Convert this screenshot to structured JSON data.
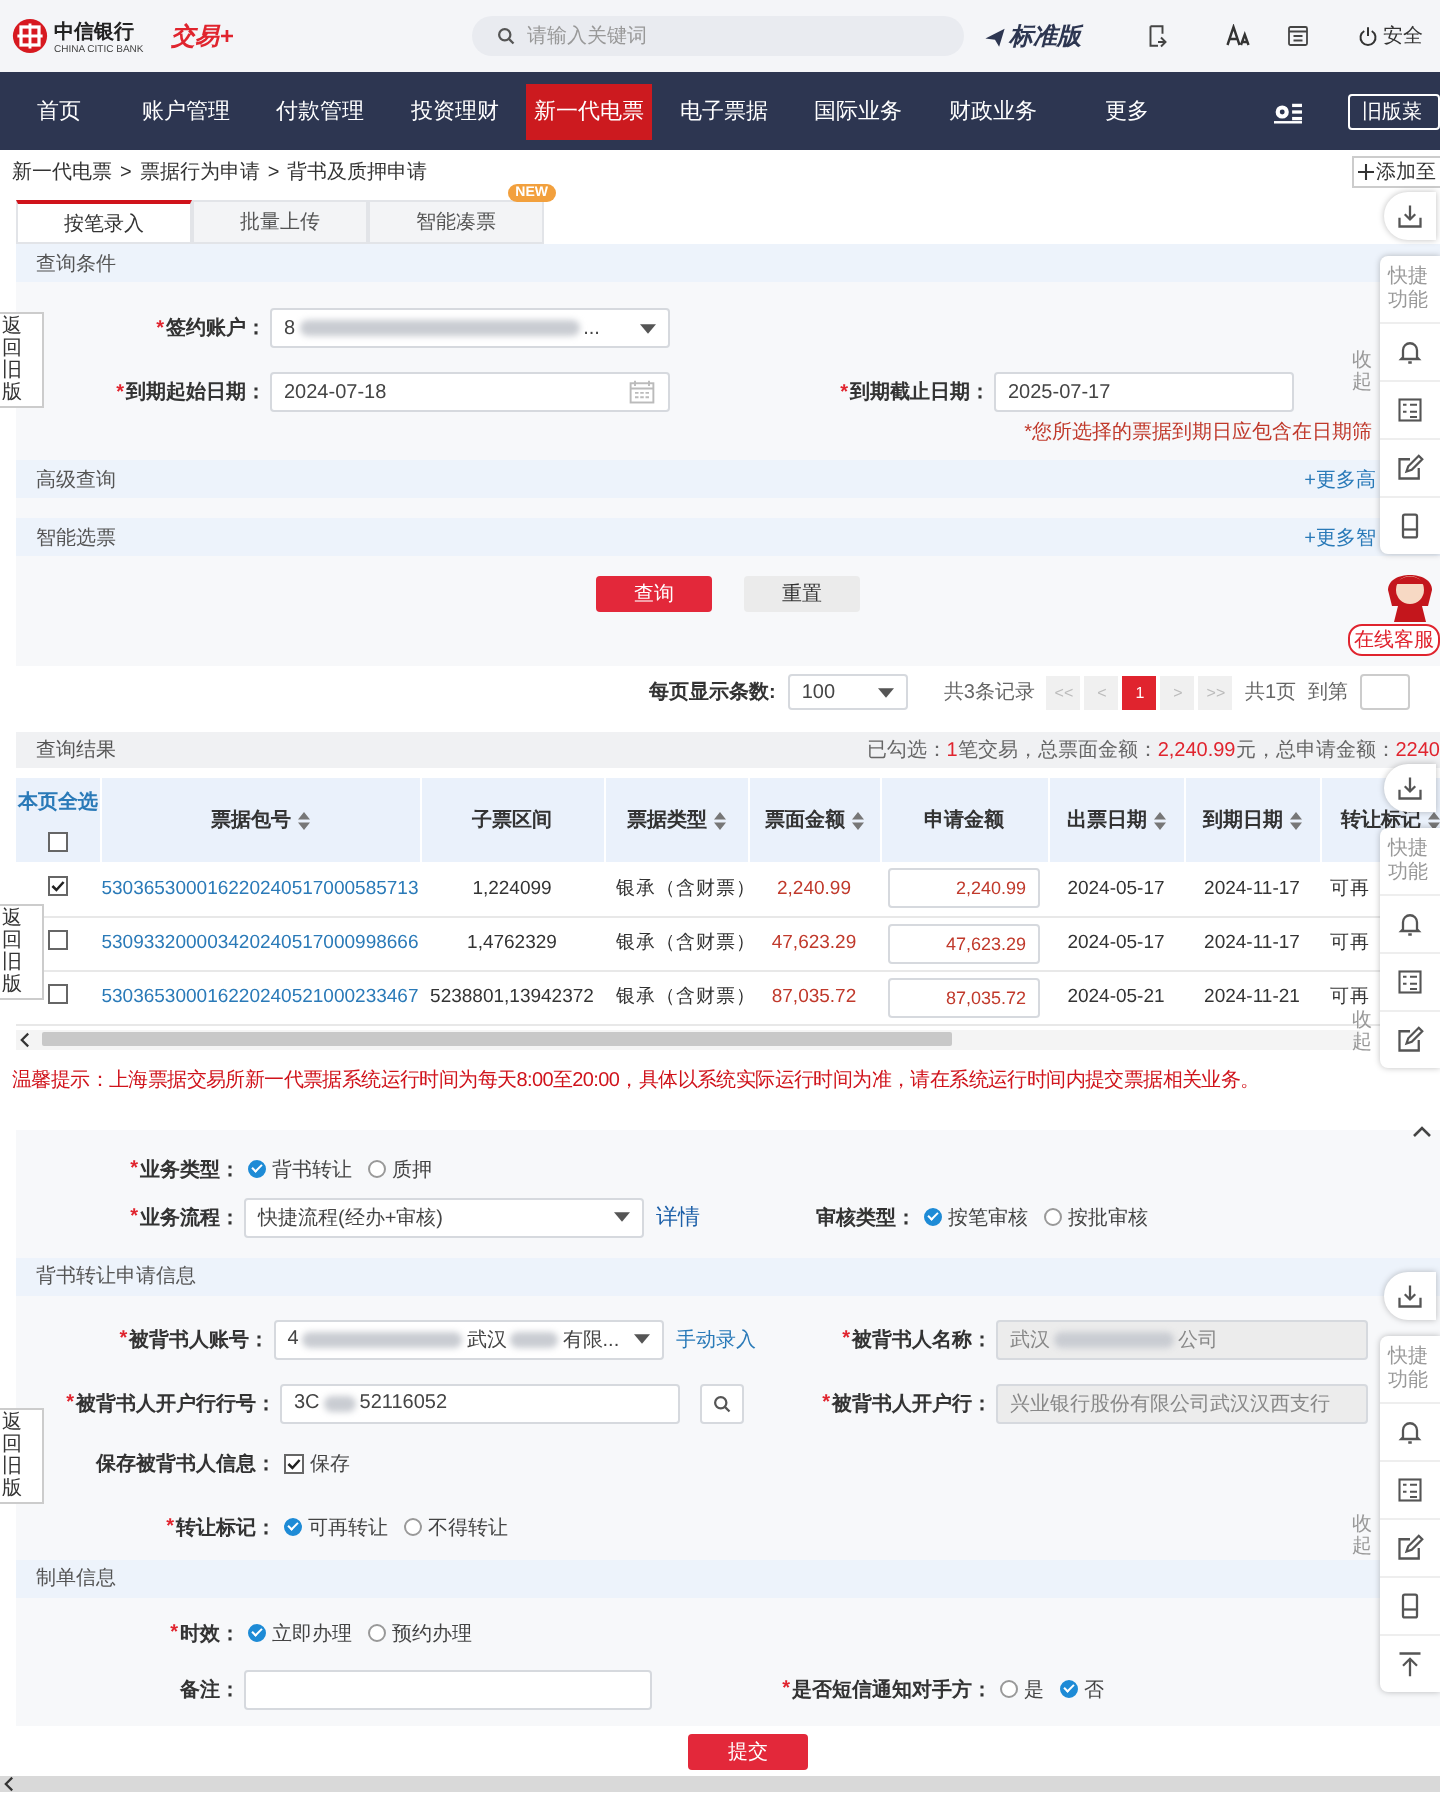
{
  "header": {
    "bank_name": "中信银行",
    "bank_name_en": "CHINA CITIC BANK",
    "app_logo": "交易+",
    "search": {
      "placeholder": "请输入关键词"
    },
    "edition": "标准版",
    "security": "安全"
  },
  "nav": {
    "items": [
      {
        "label": "首页",
        "selected": false
      },
      {
        "label": "账户管理",
        "selected": false
      },
      {
        "label": "付款管理",
        "selected": false
      },
      {
        "label": "投资理财",
        "selected": false
      },
      {
        "label": "新一代电票",
        "selected": true
      },
      {
        "label": "电子票据",
        "selected": false
      },
      {
        "label": "国际业务",
        "selected": false
      },
      {
        "label": "财政业务",
        "selected": false
      },
      {
        "label": "更多",
        "selected": false
      }
    ],
    "old_menu": "旧版菜"
  },
  "breadcrumb": {
    "items": [
      "新一代电票",
      "票据行为申请",
      "背书及质押申请"
    ],
    "separator": ">",
    "add": "添加至"
  },
  "tabs": [
    {
      "label": "按笔录入",
      "selected": true
    },
    {
      "label": "批量上传",
      "selected": false
    },
    {
      "label": "智能凑票",
      "selected": false,
      "badge": "NEW"
    }
  ],
  "query": {
    "title": "查询条件",
    "account": {
      "mark": "*",
      "label": "签约账户：",
      "value": "8",
      "value_end": "..."
    },
    "start_date": {
      "mark": "*",
      "label": "到期起始日期：",
      "value": "2024-07-18"
    },
    "end_date": {
      "mark": "*",
      "label": "到期截止日期：",
      "value": "2025-07-17"
    },
    "note": "*您所选择的票据到期日应包含在日期筛",
    "bars": [
      {
        "title": "高级查询",
        "link": "+更多高"
      },
      {
        "title": "智能选票",
        "link": "+更多智"
      }
    ],
    "buttons": [
      {
        "label": "查询",
        "kind": "primary"
      },
      {
        "label": "重置",
        "kind": "secondary"
      }
    ]
  },
  "pager": {
    "size_label": "每页显示条数:",
    "size": "100",
    "total": "共3条记录",
    "pages": [
      {
        "label": "<<",
        "selected": false
      },
      {
        "label": "<",
        "selected": false
      },
      {
        "label": "1",
        "selected": true
      },
      {
        "label": ">",
        "selected": false
      },
      {
        "label": ">>",
        "selected": false
      }
    ],
    "page_count": "共1页",
    "goto_label": "到第"
  },
  "results": {
    "title": "查询结果",
    "summary": [
      {
        "text": "已勾选：",
        "kind": "label"
      },
      {
        "text": "1",
        "kind": "value"
      },
      {
        "text": "笔交易，总票面金额：",
        "kind": "label"
      },
      {
        "text": "2,240.99",
        "kind": "value"
      },
      {
        "text": "元，总申请金额：",
        "kind": "label"
      },
      {
        "text": "2240",
        "kind": "value"
      }
    ],
    "select_all": {
      "label": "本页全选",
      "checked": false
    },
    "columns": [
      {
        "label": "票据包号",
        "sortable": true
      },
      {
        "label": "子票区间",
        "sortable": false
      },
      {
        "label": "票据类型",
        "sortable": true
      },
      {
        "label": "票面金额",
        "sortable": true
      },
      {
        "label": "申请金额",
        "sortable": false
      },
      {
        "label": "出票日期",
        "sortable": true
      },
      {
        "label": "到期日期",
        "sortable": true
      },
      {
        "label": "转让标记",
        "sortable": true
      }
    ],
    "rows": [
      {
        "checked": true,
        "package_no": "530365300016220240517000585713",
        "sub_range": "1,224099",
        "bill_type": "银承（含财票）",
        "face_amount": "2,240.99",
        "apply_amount": "2,240.99",
        "issue_date": "2024-05-17",
        "due_date": "2024-11-17",
        "transfer": "可再"
      },
      {
        "checked": false,
        "package_no": "530933200003420240517000998666",
        "sub_range": "1,4762329",
        "bill_type": "银承（含财票）",
        "face_amount": "47,623.29",
        "apply_amount": "47,623.29",
        "issue_date": "2024-05-17",
        "due_date": "2024-11-17",
        "transfer": "可再"
      },
      {
        "checked": false,
        "package_no": "530365300016220240521000233467",
        "sub_range": "5238801,13942372",
        "bill_type": "银承（含财票）",
        "face_amount": "87,035.72",
        "apply_amount": "87,035.72",
        "issue_date": "2024-05-21",
        "due_date": "2024-11-21",
        "transfer": "可再"
      }
    ]
  },
  "warning": "温馨提示：上海票据交易所新一代票据系统运行时间为每天8:00至20:00，具体以系统实际运行时间为准，请在系统运行时间内提交票据相关业务。",
  "form": {
    "business_type": {
      "mark": "*",
      "label": "业务类型：",
      "options": [
        {
          "label": "背书转让",
          "selected": true
        },
        {
          "label": "质押",
          "selected": false
        }
      ]
    },
    "process": {
      "mark": "*",
      "label": "业务流程：",
      "value": "快捷流程(经办+审核)",
      "link": "详情"
    },
    "review_type": {
      "label": "审核类型：",
      "options": [
        {
          "label": "按笔审核",
          "selected": true
        },
        {
          "label": "按批审核",
          "selected": false
        }
      ]
    },
    "endorse_section": "背书转让申请信息",
    "endorsee_account": {
      "mark": "*",
      "label": "被背书人账号：",
      "value": "4",
      "value_mid": "武汉",
      "value_end": "有限...",
      "link": "手动录入"
    },
    "endorsee_name": {
      "mark": "*",
      "label": "被背书人名称：",
      "value": "武汉",
      "value_end": "公司",
      "disabled": true
    },
    "bank_code": {
      "mark": "*",
      "label": "被背书人开户行行号：",
      "value": "3C",
      "value_end": "52116052"
    },
    "bank_name": {
      "mark": "*",
      "label": "被背书人开户行：",
      "value": "兴业银行股份有限公司武汉汉西支行",
      "disabled": true
    },
    "save_info": {
      "label": "保存被背书人信息：",
      "option": {
        "label": "保存",
        "checked": true
      }
    },
    "transfer_mark": {
      "mark": "*",
      "label": "转让标记：",
      "options": [
        {
          "label": "可再转让",
          "selected": true
        },
        {
          "label": "不得转让",
          "selected": false
        }
      ]
    },
    "order_section": "制单信息",
    "timing": {
      "mark": "*",
      "label": "时效：",
      "options": [
        {
          "label": "立即办理",
          "selected": true
        },
        {
          "label": "预约办理",
          "selected": false
        }
      ]
    },
    "remark": {
      "label": "备注："
    },
    "sms": {
      "mark": "*",
      "label": "是否短信通知对手方：",
      "options": [
        {
          "label": "是",
          "selected": false
        },
        {
          "label": "否",
          "selected": true
        }
      ]
    }
  },
  "submit": "提交",
  "side_toolbars": [
    {
      "items": [
        {
          "kind": "download"
        },
        {
          "kind": "text",
          "label": "快捷功能"
        },
        {
          "kind": "bell"
        },
        {
          "kind": "list"
        },
        {
          "kind": "edit"
        },
        {
          "kind": "phone"
        }
      ],
      "collapse": "收起",
      "assistant": "在线客服"
    },
    {
      "items": [
        {
          "kind": "download"
        },
        {
          "kind": "text",
          "label": "快捷功能"
        },
        {
          "kind": "bell"
        },
        {
          "kind": "list"
        },
        {
          "kind": "edit"
        }
      ],
      "collapse": "收起"
    },
    {
      "items": [
        {
          "kind": "download"
        },
        {
          "kind": "text",
          "label": "快捷功能"
        },
        {
          "kind": "bell"
        },
        {
          "kind": "list"
        },
        {
          "kind": "edit"
        },
        {
          "kind": "phone"
        },
        {
          "kind": "top"
        }
      ],
      "collapse": "收起"
    }
  ],
  "old_version_tabs": [
    "返回旧版",
    "返回旧版",
    "返回旧版"
  ]
}
